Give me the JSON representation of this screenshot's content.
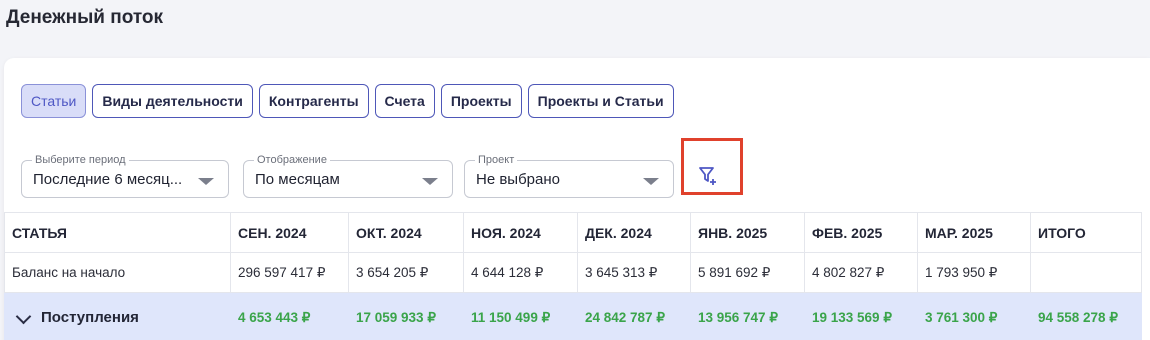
{
  "page": {
    "title": "Денежный поток"
  },
  "tabs": [
    {
      "label": "Статьи",
      "active": true
    },
    {
      "label": "Виды деятельности",
      "active": false
    },
    {
      "label": "Контрагенты",
      "active": false
    },
    {
      "label": "Счета",
      "active": false
    },
    {
      "label": "Проекты",
      "active": false
    },
    {
      "label": "Проекты и Статьи",
      "active": false
    }
  ],
  "filters": {
    "period": {
      "label": "Выберите период",
      "value": "Последние 6 месяц..."
    },
    "display": {
      "label": "Отображение",
      "value": "По месяцам"
    },
    "project": {
      "label": "Проект",
      "value": "Не выбрано"
    },
    "add_filter_icon": "filter-plus-icon"
  },
  "colors": {
    "accent": "#4e57b8",
    "positive": "#3aa44a",
    "highlight": "#e0412c",
    "income_row_bg": "#dfe6fb"
  },
  "table": {
    "headers": [
      "СТАТЬЯ",
      "СЕН. 2024",
      "ОКТ. 2024",
      "НОЯ. 2024",
      "ДЕК. 2024",
      "ЯНВ. 2025",
      "ФЕВ. 2025",
      "МАР. 2025",
      "ИТОГО"
    ],
    "rows": [
      {
        "name": "Баланс на начало",
        "values": [
          "296 597 417 ₽",
          "3 654 205 ₽",
          "4 644 128 ₽",
          "3 645 313 ₽",
          "5 891 692 ₽",
          "4 802 827 ₽",
          "1 793 950 ₽",
          ""
        ]
      },
      {
        "name": "Поступления",
        "expanded": true,
        "values": [
          "4 653 443 ₽",
          "17 059 933 ₽",
          "11 150 499 ₽",
          "24 842 787 ₽",
          "13 956 747 ₽",
          "19 133 569 ₽",
          "3 761 300 ₽",
          "94 558 278 ₽"
        ]
      }
    ]
  }
}
